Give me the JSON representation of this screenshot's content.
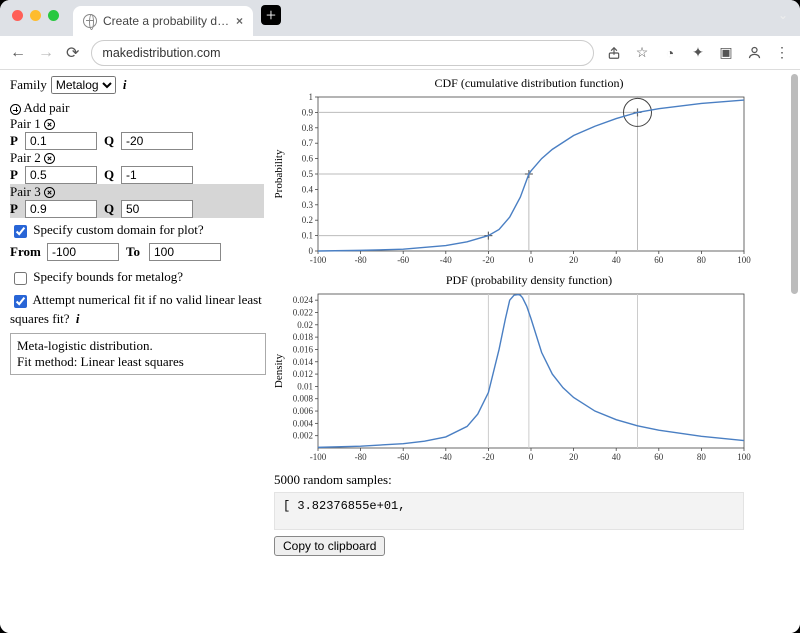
{
  "browser": {
    "tab_title": "Create a probability distribution",
    "url": "makedistribution.com"
  },
  "sidebar": {
    "family_label": "Family",
    "family_value": "Metalog",
    "add_pair_label": "Add pair",
    "pairs": [
      {
        "label": "Pair 1",
        "p": "0.1",
        "q": "-20"
      },
      {
        "label": "Pair 2",
        "p": "0.5",
        "q": "-1"
      },
      {
        "label": "Pair 3",
        "p": "0.9",
        "q": "50"
      }
    ],
    "p_label": "P",
    "q_label": "Q",
    "custom_domain_label": "Specify custom domain for plot?",
    "custom_domain_checked": true,
    "from_label": "From",
    "from_value": "-100",
    "to_label": "To",
    "to_value": "100",
    "bounds_label": "Specify bounds for metalog?",
    "bounds_checked": false,
    "numerical_fit_label": "Attempt numerical fit if no valid linear least squares fit?",
    "numerical_fit_checked": true,
    "fit_box_line1": "Meta-logistic distribution.",
    "fit_box_line2": "Fit method: Linear least squares"
  },
  "samples": {
    "heading": "5000 random samples:",
    "preview": "[ 3.82376855e+01,",
    "copy_button": "Copy to clipboard"
  },
  "chart_data": [
    {
      "type": "line",
      "title": "CDF (cumulative distribution function)",
      "xlabel": "",
      "ylabel": "Probability",
      "xlim": [
        -100,
        100
      ],
      "ylim": [
        0,
        1.0
      ],
      "xticks": [
        -100,
        -80,
        -60,
        -40,
        -20,
        0,
        20,
        40,
        60,
        80,
        100
      ],
      "yticks": [
        0.0,
        0.1,
        0.2,
        0.3,
        0.4,
        0.5,
        0.6,
        0.7,
        0.8,
        0.9,
        1.0
      ],
      "series": [
        {
          "name": "CDF",
          "x": [
            -100,
            -80,
            -60,
            -40,
            -30,
            -20,
            -15,
            -10,
            -5,
            -1,
            0,
            5,
            10,
            20,
            30,
            40,
            50,
            60,
            80,
            100
          ],
          "y": [
            0.0,
            0.004,
            0.012,
            0.035,
            0.06,
            0.1,
            0.14,
            0.22,
            0.35,
            0.5,
            0.52,
            0.6,
            0.66,
            0.75,
            0.81,
            0.86,
            0.9,
            0.924,
            0.958,
            0.98
          ]
        }
      ],
      "markers": [
        {
          "x": -20,
          "y": 0.1
        },
        {
          "x": -1,
          "y": 0.5
        },
        {
          "x": 50,
          "y": 0.9,
          "highlight": true
        }
      ]
    },
    {
      "type": "line",
      "title": "PDF (probability density function)",
      "xlabel": "",
      "ylabel": "Density",
      "xlim": [
        -100,
        100
      ],
      "ylim": [
        0,
        0.025
      ],
      "xticks": [
        -100,
        -80,
        -60,
        -40,
        -20,
        0,
        20,
        40,
        60,
        80,
        100
      ],
      "yticks": [
        0.002,
        0.004,
        0.006,
        0.008,
        0.01,
        0.012,
        0.014,
        0.016,
        0.018,
        0.02,
        0.022,
        0.024
      ],
      "series": [
        {
          "name": "PDF",
          "x": [
            -100,
            -80,
            -60,
            -50,
            -40,
            -30,
            -25,
            -20,
            -15,
            -12,
            -10,
            -8,
            -6,
            -5,
            -4,
            -2,
            0,
            5,
            10,
            15,
            20,
            30,
            40,
            50,
            60,
            80,
            100
          ],
          "y": [
            0.0001,
            0.0003,
            0.0007,
            0.0011,
            0.0018,
            0.0035,
            0.0055,
            0.009,
            0.016,
            0.021,
            0.024,
            0.0248,
            0.0249,
            0.0248,
            0.0244,
            0.023,
            0.021,
            0.0155,
            0.012,
            0.0098,
            0.0082,
            0.006,
            0.0046,
            0.0036,
            0.0029,
            0.0019,
            0.0012
          ]
        }
      ],
      "vlines": [
        -20,
        -1,
        50
      ]
    }
  ]
}
